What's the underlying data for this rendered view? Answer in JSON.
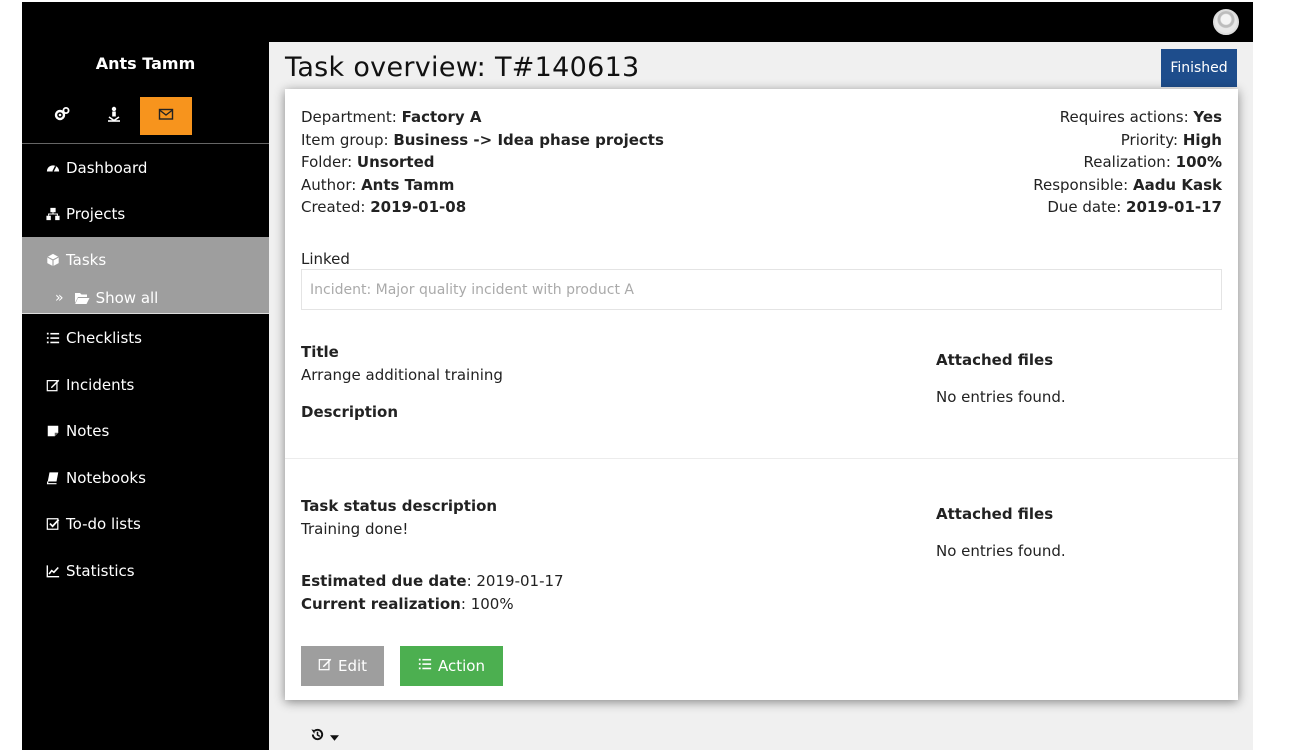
{
  "user": {
    "name": "Ants Tamm"
  },
  "sidebar": {
    "icon_buttons": [
      {
        "icon": "cogs-icon"
      },
      {
        "icon": "user-down-icon"
      },
      {
        "icon": "envelope-icon",
        "active": true
      }
    ],
    "items": [
      {
        "label": "Dashboard",
        "icon": "dashboard-icon"
      },
      {
        "label": "Projects",
        "icon": "sitemap-icon"
      },
      {
        "label": "Tasks",
        "icon": "cube-icon",
        "active": true
      },
      {
        "label": "Checklists",
        "icon": "list-ol-icon"
      },
      {
        "label": "Incidents",
        "icon": "edit-icon"
      },
      {
        "label": "Notes",
        "icon": "sticky-note-icon"
      },
      {
        "label": "Notebooks",
        "icon": "book-icon"
      },
      {
        "label": "To-do lists",
        "icon": "check-square-icon"
      },
      {
        "label": "Statistics",
        "icon": "line-chart-icon"
      }
    ],
    "tasks_sub": {
      "label": "Show all",
      "icon": "folder-open-icon"
    }
  },
  "page": {
    "title": "Task overview: T#140613",
    "status": "Finished",
    "status_color": "#1e4d8c"
  },
  "meta_left": [
    {
      "label": "Department",
      "value": "Factory A"
    },
    {
      "label": "Item group",
      "value": "Business -> Idea phase projects"
    },
    {
      "label": "Folder",
      "value": "Unsorted"
    },
    {
      "label": "Author",
      "value": "Ants Tamm"
    },
    {
      "label": "Created",
      "value": "2019-01-08"
    }
  ],
  "meta_right": [
    {
      "label": "Requires actions",
      "value": "Yes"
    },
    {
      "label": "Priority",
      "value": "High"
    },
    {
      "label": "Realization",
      "value": "100%"
    },
    {
      "label": "Responsible",
      "value": "Aadu Kask"
    },
    {
      "label": "Due date",
      "value": "2019-01-17"
    }
  ],
  "linked": {
    "label": "Linked",
    "value": "Incident: Major quality incident with product A"
  },
  "section1": {
    "title_label": "Title",
    "title_value": "Arrange additional training",
    "description_label": "Description",
    "files_label": "Attached files",
    "files_empty": "No entries found."
  },
  "section2": {
    "status_label": "Task status description",
    "status_value": "Training done!",
    "est_label": "Estimated due date",
    "est_value": "2019-01-17",
    "real_label": "Current realization",
    "real_value": "100%",
    "files_label": "Attached files",
    "files_empty": "No entries found."
  },
  "buttons": {
    "edit": "Edit",
    "action": "Action"
  },
  "colors": {
    "accent_orange": "#f7941d",
    "edit_button": "#9e9e9e",
    "action_button": "#4caf50"
  }
}
